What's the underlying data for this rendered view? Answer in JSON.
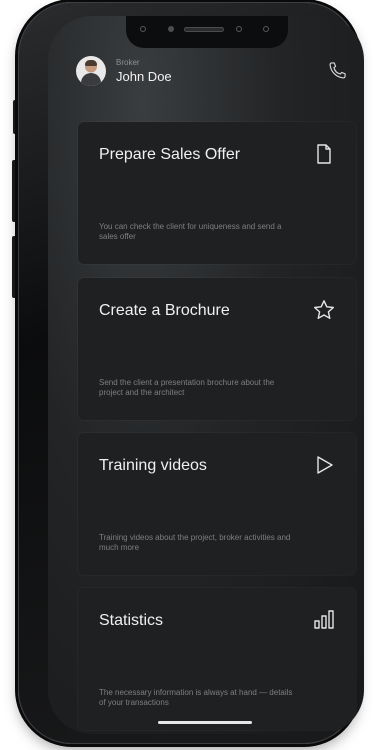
{
  "header": {
    "role": "Broker",
    "name": "John Doe"
  },
  "cards": [
    {
      "title": "Prepare Sales Offer",
      "description": "You can check the client for uniqueness and send a sales offer",
      "icon": "document-icon"
    },
    {
      "title": "Create a Brochure",
      "description": "Send the client a presentation brochure about the project and the architect",
      "icon": "star-icon"
    },
    {
      "title": "Training videos",
      "description": "Training videos about the project, broker activities and much more",
      "icon": "play-icon"
    },
    {
      "title": "Statistics",
      "description": "The necessary information is always at hand — details of your transactions",
      "icon": "bar-chart-icon"
    }
  ],
  "colors": {
    "card_bg": "#1f2022",
    "title": "#f0f0f0",
    "muted": "#7d7f82"
  }
}
